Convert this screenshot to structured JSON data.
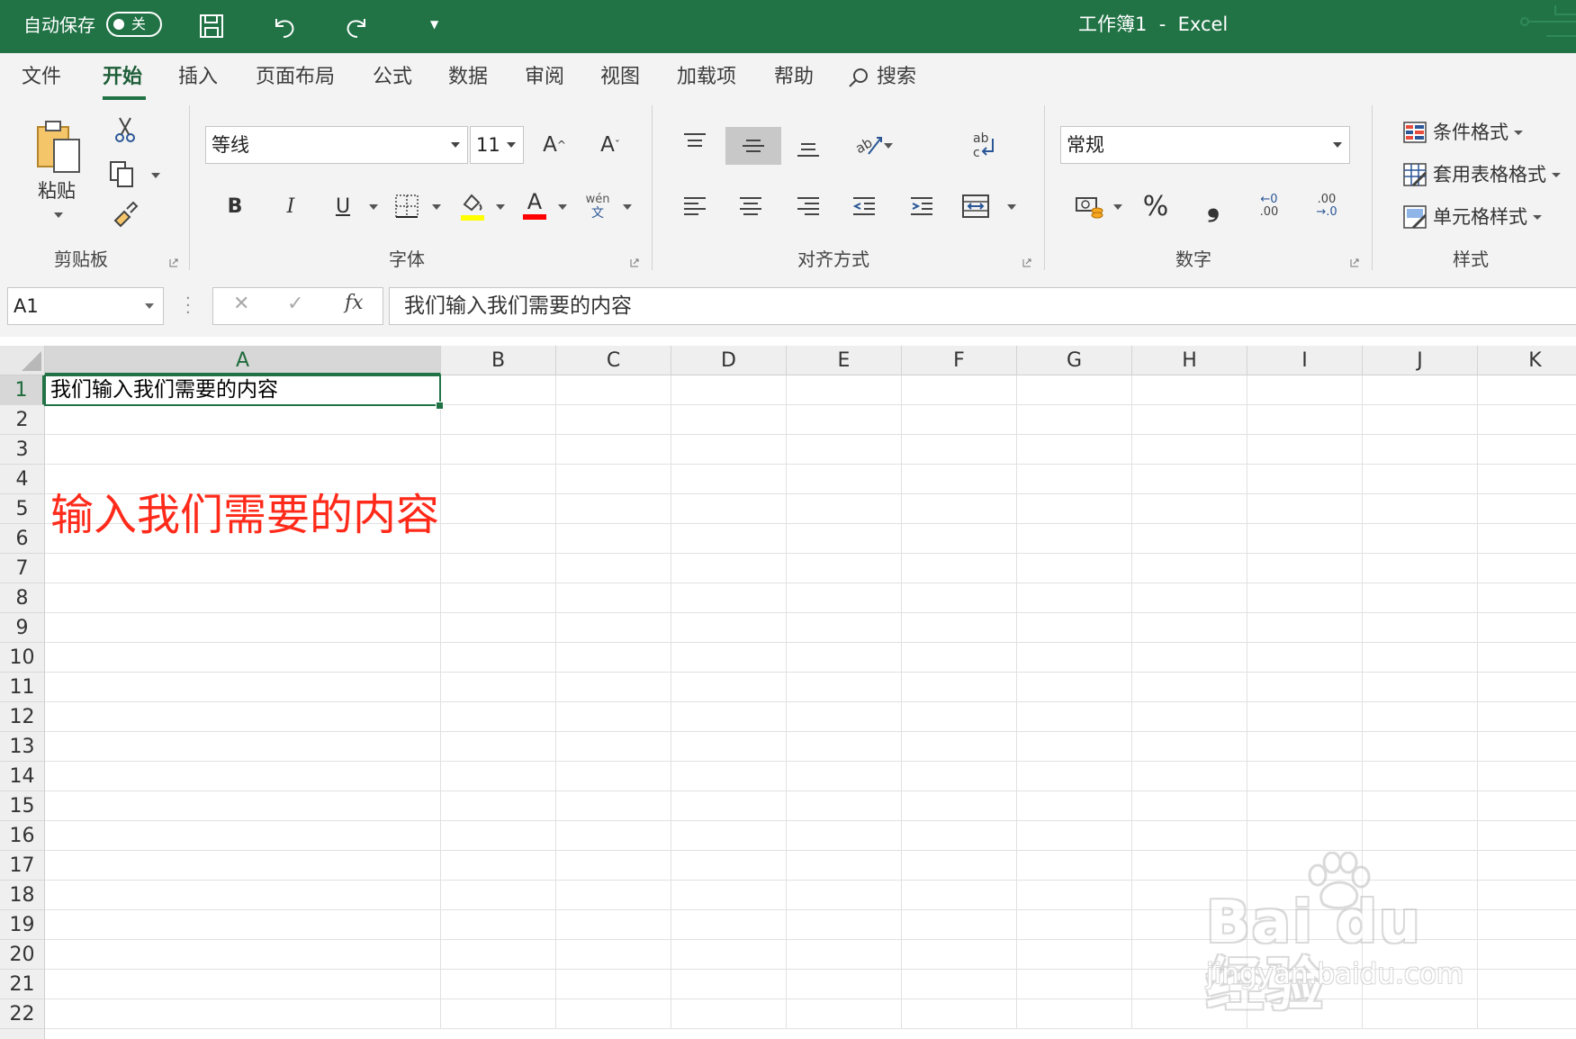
{
  "titlebar": {
    "autosave_label": "自动保存",
    "autosave_state": "关",
    "window_title": "工作簿1  -  Excel",
    "bg_color": "#217346"
  },
  "tabs": [
    "文件",
    "开始",
    "插入",
    "页面布局",
    "公式",
    "数据",
    "审阅",
    "视图",
    "加载项",
    "帮助"
  ],
  "search_label": "搜索",
  "ribbon": {
    "clipboard": {
      "paste_label": "粘贴",
      "group_label": "剪贴板"
    },
    "font": {
      "font_name": "等线",
      "font_size": "11",
      "group_label": "字体",
      "phonetic_top": "wén",
      "phonetic_bottom": "文"
    },
    "alignment": {
      "group_label": "对齐方式"
    },
    "number": {
      "format": "常规",
      "group_label": "数字",
      "percent": "%",
      "comma": "❟",
      "inc_decimal_top": "←0",
      "inc_decimal_bottom": ".00",
      "dec_decimal_top": ".00",
      "dec_decimal_bottom": "→.0"
    },
    "styles": {
      "conditional": "条件格式",
      "table": "套用表格格式",
      "cell": "单元格样式",
      "group_label": "样式"
    }
  },
  "formula_bar": {
    "name_box": "A1",
    "cancel": "✕",
    "enter": "✓",
    "fx": "fx",
    "content": "我们输入我们需要的内容"
  },
  "sheet": {
    "columns": [
      "A",
      "B",
      "C",
      "D",
      "E",
      "F",
      "G",
      "H",
      "I",
      "J",
      "K"
    ],
    "rows": [
      "1",
      "2",
      "3",
      "4",
      "5",
      "6",
      "7",
      "8",
      "9",
      "10",
      "11",
      "12",
      "13",
      "14",
      "15",
      "16",
      "17",
      "18",
      "19",
      "20",
      "21",
      "22"
    ],
    "selected_cell": "A1",
    "a1_value": "我们输入我们需要的内容",
    "annotation": "输入我们需要的内容",
    "annotation_color": "#ff2a1a"
  },
  "watermark": {
    "main": "Bai du 经验",
    "sub": "jingyan.baidu.com"
  }
}
